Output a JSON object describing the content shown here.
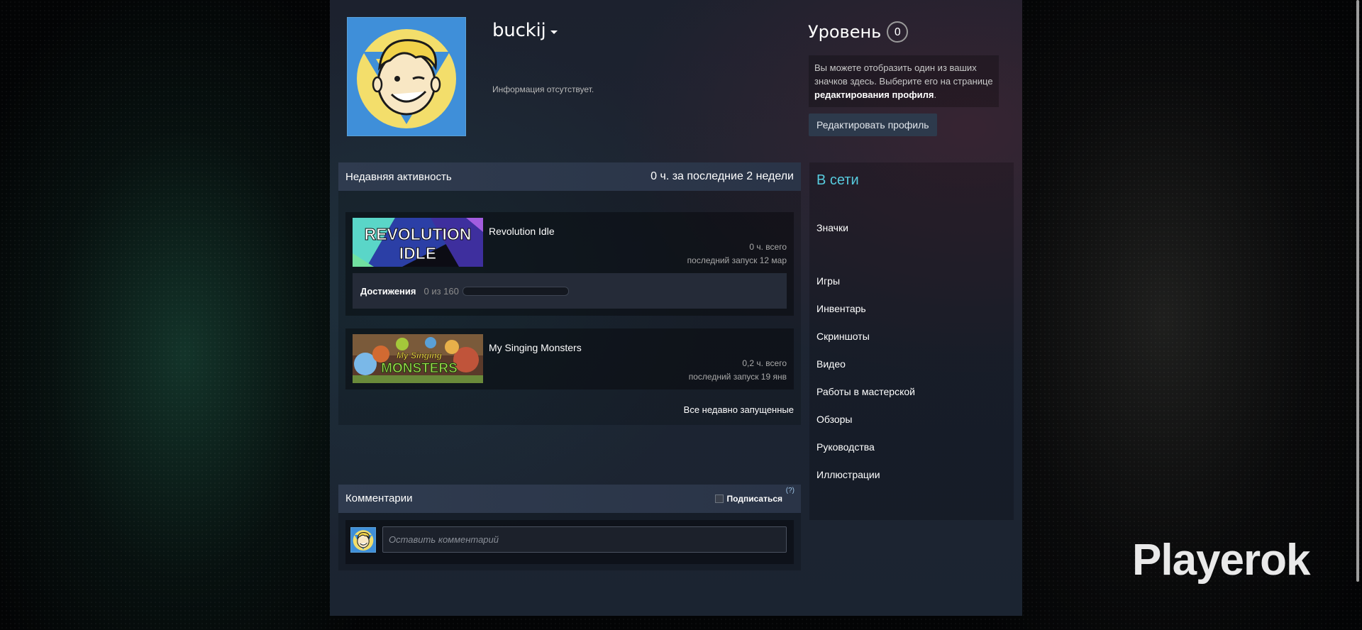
{
  "profile": {
    "persona_name": "buckij",
    "summary": "Информация отсутствует.",
    "level_label": "Уровень",
    "level_value": "0",
    "badge_note_text": "Вы можете отобразить один из ваших значков здесь. Выберите его на странице ",
    "badge_note_link": "редактирования профиля",
    "badge_note_end": ".",
    "edit_button": "Редактировать профиль"
  },
  "activity": {
    "title": "Недавняя активность",
    "playtime_summary": "0 ч. за последние 2 недели",
    "games": [
      {
        "name": "Revolution Idle",
        "hours": "0 ч. всего",
        "last_played": "последний запуск 12 мар",
        "capsule_text_1": "REVOLUTION",
        "capsule_text_2": "IDLE",
        "achievements_label": "Достижения",
        "achievements_count": "0 из 160",
        "achievements_fraction": 0
      },
      {
        "name": "My Singing Monsters",
        "hours": "0,2 ч. всего",
        "last_played": "последний запуск 19 янв",
        "capsule_text_1": "My Singing",
        "capsule_text_2": "MONSTERS"
      }
    ],
    "all_recent_link": "Все недавно запущенные"
  },
  "comments": {
    "title": "Комментарии",
    "subscribe_label": "Подписаться",
    "help": "(?)",
    "placeholder": "Оставить комментарий"
  },
  "sidebar": {
    "status": "В сети",
    "links": [
      "Значки",
      "Игры",
      "Инвентарь",
      "Скриншоты",
      "Видео",
      "Работы в мастерской",
      "Обзоры",
      "Руководства",
      "Иллюстрации"
    ]
  },
  "watermark": "Playerok",
  "colors": {
    "accent_online": "#57cbde",
    "avatar_bg": "#3a6ea5",
    "avatar_border": "#5aa0d6"
  }
}
